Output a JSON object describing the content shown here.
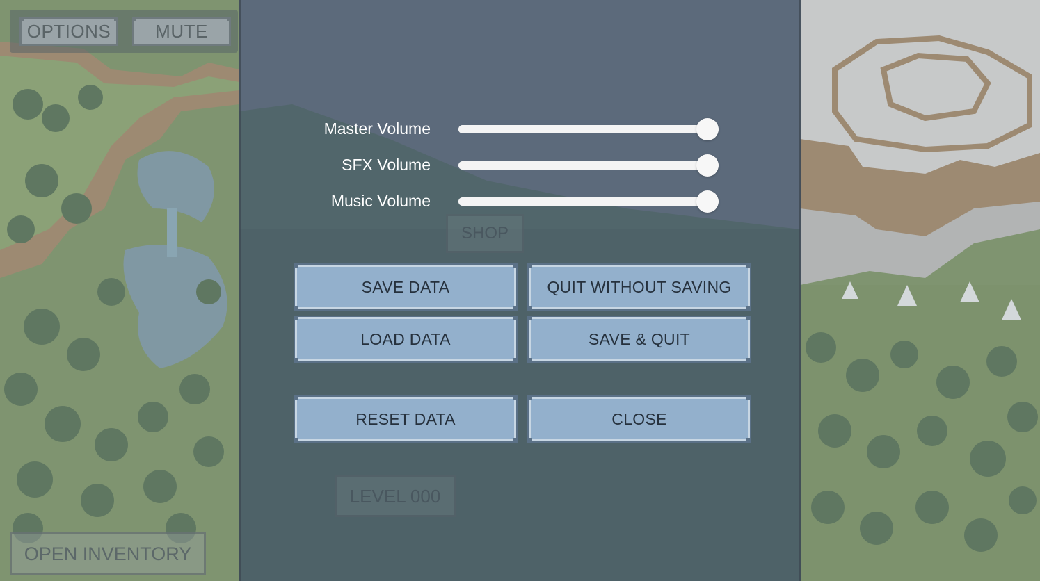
{
  "hud": {
    "options_label": "OPTIONS",
    "mute_label": "MUTE",
    "open_inventory_label": "OPEN INVENTORY"
  },
  "map_labels": {
    "shop": "SHOP",
    "level": "LEVEL 000"
  },
  "options_menu": {
    "sliders": [
      {
        "label": "Master Volume",
        "value": 1.0
      },
      {
        "label": "SFX Volume",
        "value": 1.0
      },
      {
        "label": "Music Volume",
        "value": 1.0
      }
    ],
    "buttons": {
      "save_data": "SAVE DATA",
      "quit_without_saving": "QUIT WITHOUT SAVING",
      "load_data": "LOAD DATA",
      "save_and_quit": "SAVE & QUIT",
      "reset_data": "RESET DATA",
      "close": "CLOSE"
    }
  },
  "colors": {
    "panel_overlay": "#4e6076",
    "button_fill": "#93b0cc",
    "button_text": "#26313d",
    "slider": "#f4f4f4"
  }
}
